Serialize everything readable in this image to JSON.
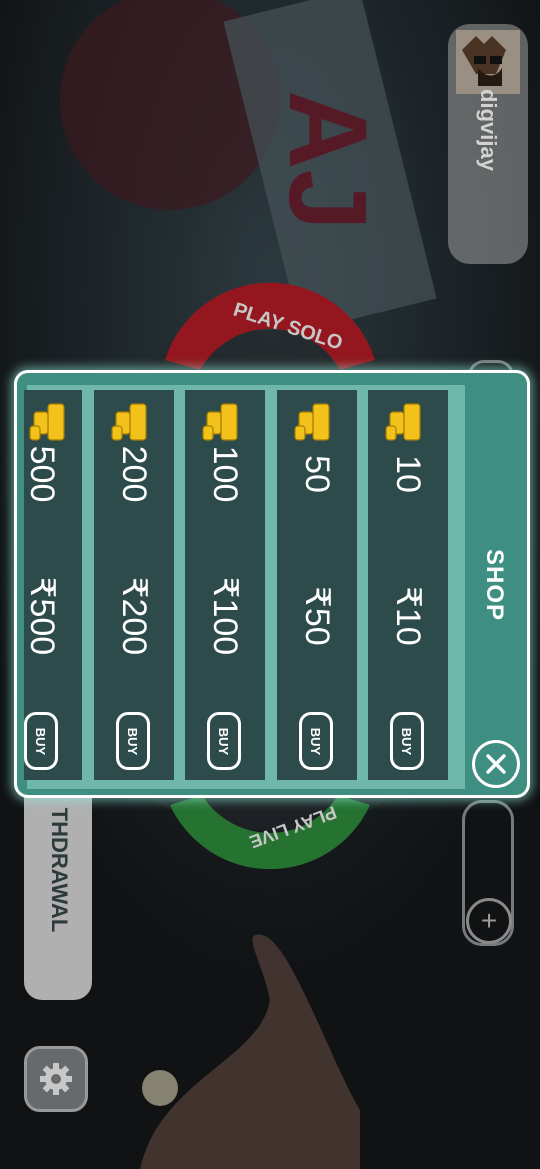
{
  "profile": {
    "username": "digvijay"
  },
  "nav": {
    "withdrawal_label": "THDRAWAL",
    "play_solo": "PLAY SOLO",
    "play_live": "PLAY LIVE"
  },
  "shop": {
    "title": "SHOP",
    "packages": [
      {
        "coins": "10",
        "price": "₹10",
        "buy_label": "BUY"
      },
      {
        "coins": "50",
        "price": "₹50",
        "buy_label": "BUY"
      },
      {
        "coins": "100",
        "price": "₹100",
        "buy_label": "BUY"
      },
      {
        "coins": "200",
        "price": "₹200",
        "buy_label": "BUY"
      },
      {
        "coins": "500",
        "price": "₹500",
        "buy_label": "BUY"
      }
    ]
  },
  "colors": {
    "modal_bg": "#3e8e81",
    "card_bg": "#2d4b4a",
    "coin": "#f2c21a",
    "accent_red": "#b51d26",
    "accent_green": "#2e8b3c"
  }
}
